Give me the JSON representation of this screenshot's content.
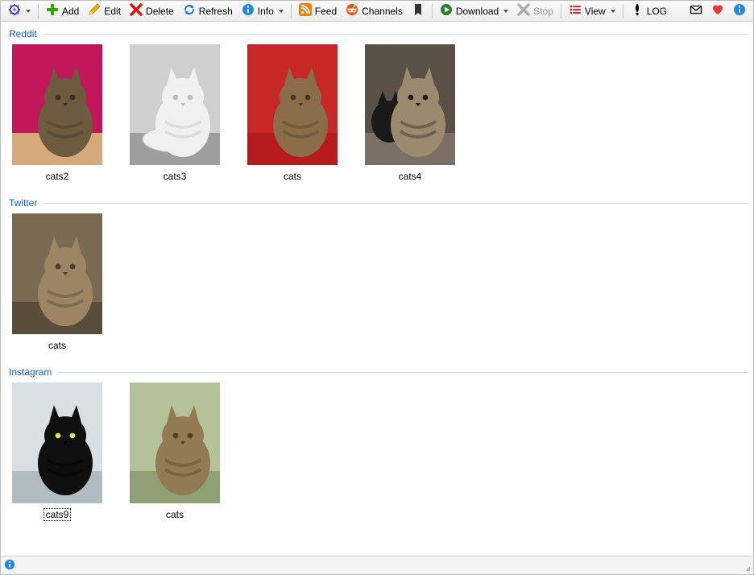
{
  "toolbar": {
    "add_label": "Add",
    "edit_label": "Edit",
    "delete_label": "Delete",
    "refresh_label": "Refresh",
    "info_label": "Info",
    "feed_label": "Feed",
    "channels_label": "Channels",
    "download_label": "Download",
    "stop_label": "Stop",
    "view_label": "View",
    "log_label": "LOG"
  },
  "groups": [
    {
      "name": "Reddit",
      "items": [
        {
          "caption": "cats2",
          "selected": false,
          "thumb": "tabby-on-pink"
        },
        {
          "caption": "cats3",
          "selected": false,
          "thumb": "white-stretching"
        },
        {
          "caption": "cats",
          "selected": false,
          "thumb": "tabby-yawn-red"
        },
        {
          "caption": "cats4",
          "selected": false,
          "thumb": "two-cats-tree"
        }
      ]
    },
    {
      "name": "Twitter",
      "items": [
        {
          "caption": "cats",
          "selected": false,
          "thumb": "tabby-upside"
        }
      ]
    },
    {
      "name": "Instagram",
      "items": [
        {
          "caption": "cats9",
          "selected": true,
          "thumb": "black-portrait"
        },
        {
          "caption": "cats",
          "selected": false,
          "thumb": "tabby-portrait"
        }
      ]
    }
  ]
}
